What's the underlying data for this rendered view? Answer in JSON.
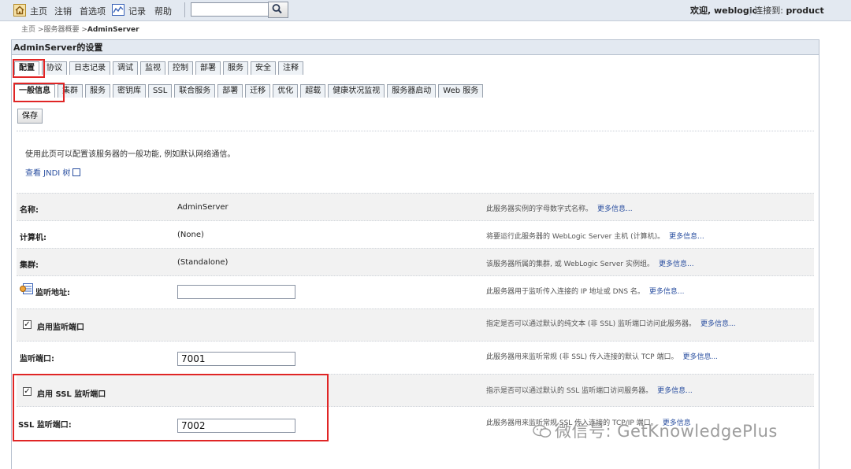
{
  "topbar": {
    "nav": [
      "主页",
      "注销",
      "首选项",
      "记录",
      "帮助"
    ],
    "search_value": "",
    "welcome": "欢迎, weblogic",
    "connect_label": "连接到:",
    "connect_value": "product"
  },
  "breadcrumb": {
    "items": [
      "主页",
      "服务器概要"
    ],
    "current": "AdminServer"
  },
  "panel": {
    "title": "AdminServer的设置",
    "main_tabs": [
      "配置",
      "协议",
      "日志记录",
      "调试",
      "监视",
      "控制",
      "部署",
      "服务",
      "安全",
      "注释"
    ],
    "sub_tabs": [
      "一般信息",
      "集群",
      "服务",
      "密钥库",
      "SSL",
      "联合服务",
      "部署",
      "迁移",
      "优化",
      "超载",
      "健康状况监视",
      "服务器启动",
      "Web 服务"
    ],
    "save_label": "保存",
    "description": "使用此页可以配置该服务器的一般功能, 例如默认网络通信。",
    "jndi_link": "查看 JNDI 树"
  },
  "fields": {
    "name": {
      "label": "名称:",
      "value": "AdminServer",
      "help": "此服务器实例的字母数字式名称。",
      "more": "更多信息..."
    },
    "machine": {
      "label": "计算机:",
      "value": "(None)",
      "help": "将要运行此服务器的 WebLogic Server 主机 (计算机)。",
      "more": "更多信息..."
    },
    "cluster": {
      "label": "集群:",
      "value": "(Standalone)",
      "help": "该服务器所属的集群, 或 WebLogic Server 实例组。",
      "more": "更多信息..."
    },
    "listen_address": {
      "label": "监听地址:",
      "value": "",
      "help": "此服务器用于监听传入连接的 IP 地址或 DNS 名。",
      "more": "更多信息..."
    },
    "listen_port_enabled": {
      "label": "启用监听端口",
      "checked": true,
      "help": "指定是否可以通过默认的纯文本 (非 SSL) 监听端口访问此服务器。",
      "more": "更多信息..."
    },
    "listen_port": {
      "label": "监听端口:",
      "value": "7001",
      "help": "此服务器用来监听常规 (非 SSL) 传入连接的默认 TCP 端口。",
      "more": "更多信息..."
    },
    "ssl_listen_port_enabled": {
      "label": "启用 SSL 监听端口",
      "checked": true,
      "help": "指示是否可以通过默认的 SSL 监听端口访问服务器。",
      "more": "更多信息..."
    },
    "ssl_listen_port": {
      "label": "SSL 监听端口:",
      "value": "7002",
      "help": "此服务器用来监听常规 SSL 传入连接的 TCP/IP 端口。",
      "more": "更多信息"
    }
  },
  "watermark": "微信号: GetKnowledgePlus",
  "colors": {
    "highlight": "#e02525",
    "link": "#2a4fa0",
    "topbar_bg": "#e3e9f1"
  }
}
